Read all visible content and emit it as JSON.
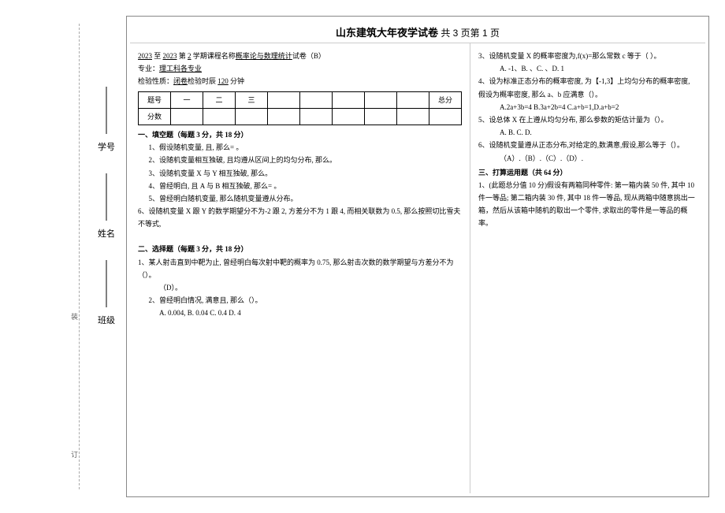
{
  "header": {
    "university": "山东建筑大年夜学试卷",
    "pageinfo": "共 3 页第 1 页"
  },
  "meta": {
    "term_line_a": "2023",
    "term_line_b": "2023",
    "term_line_c": "2",
    "term_line_d": "学期课程名称",
    "course": "概率论与数理统计",
    "paper_tail": "试卷（B）",
    "major_lbl": "专业：",
    "major": "理工科各专业",
    "exam_lbl": "检验性质：",
    "exam_type": "闭卷",
    "exam_mid": "检验时辰",
    "exam_min": "120",
    "exam_unit": "分钟"
  },
  "score": {
    "r1": [
      "题号",
      "一",
      "二",
      "三",
      "",
      "",
      "",
      "",
      "",
      "总分"
    ],
    "r2": [
      "分数",
      "",
      "",
      "",
      "",
      "",
      "",
      "",
      "",
      ""
    ]
  },
  "left": {
    "s1_title": "一、填空题（每题 3 分，共 18 分）",
    "s1": [
      "1、假设随机变量, 且, 那么= 。",
      "2、设随机变量相互独破, 且均遵从区间上的均匀分布, 那么。",
      "3、设随机变量 X 与 Y 相互独破, 那么。",
      "4、曾经明白, 且 A 与 B 相互独破, 那么= 。",
      "5、曾经明白随机变量, 那么随机变量遵从分布。",
      "6、设随机变量 X 跟 Y 的数学期望分不为-2 跟 2, 方差分不为 1 跟 4, 而相关联数为 0.5, 那么按照切比雪夫不等式,"
    ],
    "s2_title": "二、选择题（每题 3 分，共 18 分）",
    "s2": [
      "1、某人射击直到中靶为止, 曾经明白每次射中靶的概率为 0.75, 那么射击次数的数学期望与方差分不为（）。",
      "（D）。",
      "2、曾经明白情况, 满意且, 那么（）。",
      "A. 0.004, B. 0.04 C. 0.4 D. 4"
    ]
  },
  "right": {
    "lines": [
      "3、设随机变量 X 的概率密度为,f(x)=那么常数 c 等于（    ）。",
      "A. -1、B. 、C. 、D. 1",
      "4、设为标准正态分布的概率密度, 为【-1,3】上均匀分布的概率密度, 假设为概率密度, 那么 a、b 应满意（）。",
      "A.2a+3b=4 B.3a+2b=4 C.a+b=1,D.a+b=2",
      "5、设总体 X 在上遵从均匀分布, 那么参数的矩估计量为（）。",
      "A. B. C. D.",
      "6、设随机变量遵从正态分布,对给定的,数满意,假设,那么等于（）。",
      "（A）.（B）.（C）.（D）."
    ],
    "s3_title": "三、打算运用题（共 64 分）",
    "s3": [
      "1、(此题总分值 10 分)假设有两箱同种零件: 第一箱内装 50 件, 其中 10 件一等品; 第二箱内装 30 件, 其中 18 件一等品, 现从两箱中随意挑出一箱，然后从该箱中随机的取出一个零件, 求取出的零件是一等品的概率。"
    ]
  },
  "side": {
    "class_lbl": "班级",
    "name_lbl": "姓名",
    "id_lbl": "学号",
    "zhuang": "装",
    "ding": "订"
  }
}
